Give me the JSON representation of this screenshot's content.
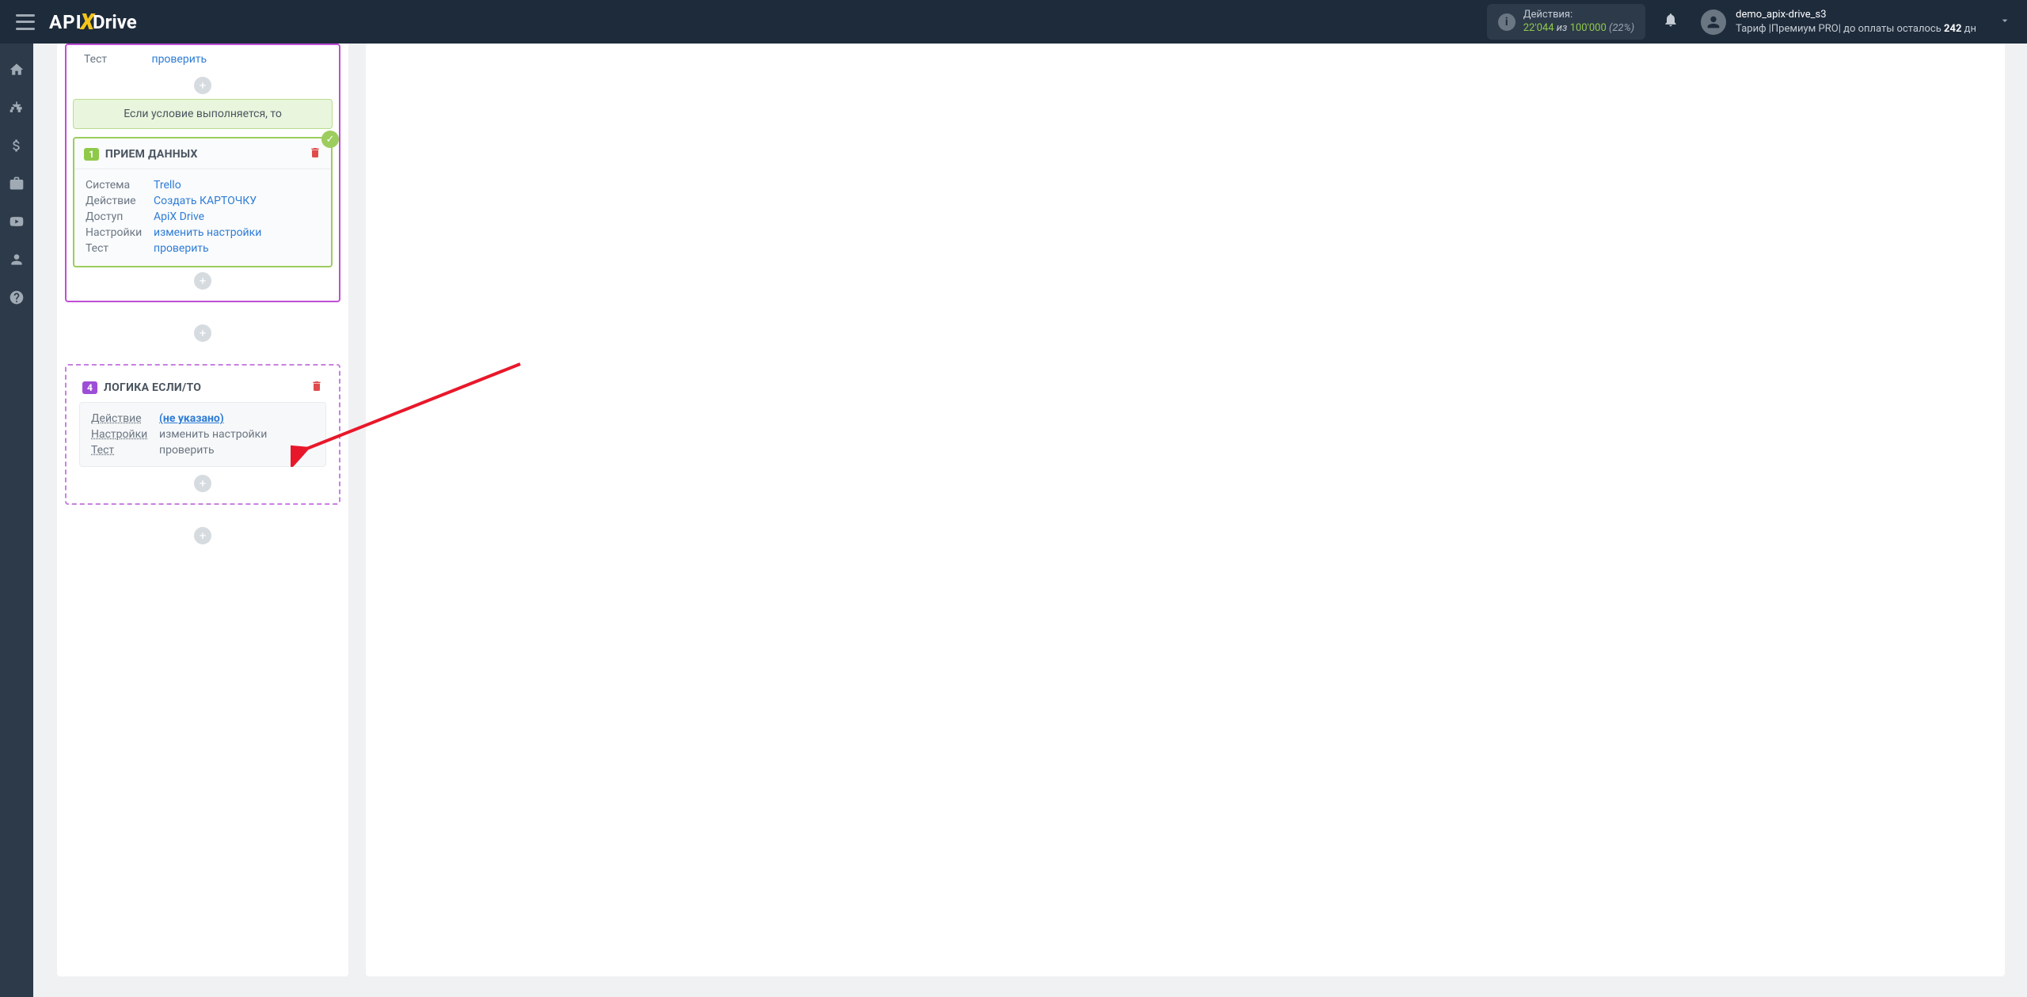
{
  "header": {
    "logo_api": "API",
    "logo_drive": "Drive",
    "actions_label": "Действия:",
    "actions_current": "22'044",
    "actions_of": "из",
    "actions_total": "100'000",
    "actions_pct": "(22%)",
    "username": "demo_apix-drive_s3",
    "tariff_prefix": "Тариф |",
    "tariff_name": "Премиум PRO",
    "tariff_sep": "| до оплаты осталось ",
    "days_left": "242",
    "days_suffix": " дн"
  },
  "partial": {
    "label": "Тест",
    "link": "проверить"
  },
  "condition_banner": "Если условие выполняется, то",
  "card1": {
    "num": "1",
    "title": "ПРИЕМ ДАННЫХ",
    "rows": [
      {
        "label": "Система",
        "value": "Trello",
        "link": true
      },
      {
        "label": "Действие",
        "value": "Создать КАРТОЧКУ",
        "link": true
      },
      {
        "label": "Доступ",
        "value": "ApiX Drive",
        "link": true
      },
      {
        "label": "Настройки",
        "value": "изменить настройки",
        "link": true
      },
      {
        "label": "Тест",
        "value": "проверить",
        "link": true
      }
    ]
  },
  "card2": {
    "num": "4",
    "title": "ЛОГИКА ЕСЛИ/ТО",
    "rows": [
      {
        "label": "Действие",
        "value": "(не указано)",
        "special": true
      },
      {
        "label": "Настройки",
        "value": "изменить настройки",
        "link": false
      },
      {
        "label": "Тест",
        "value": "проверить",
        "link": false
      }
    ]
  }
}
